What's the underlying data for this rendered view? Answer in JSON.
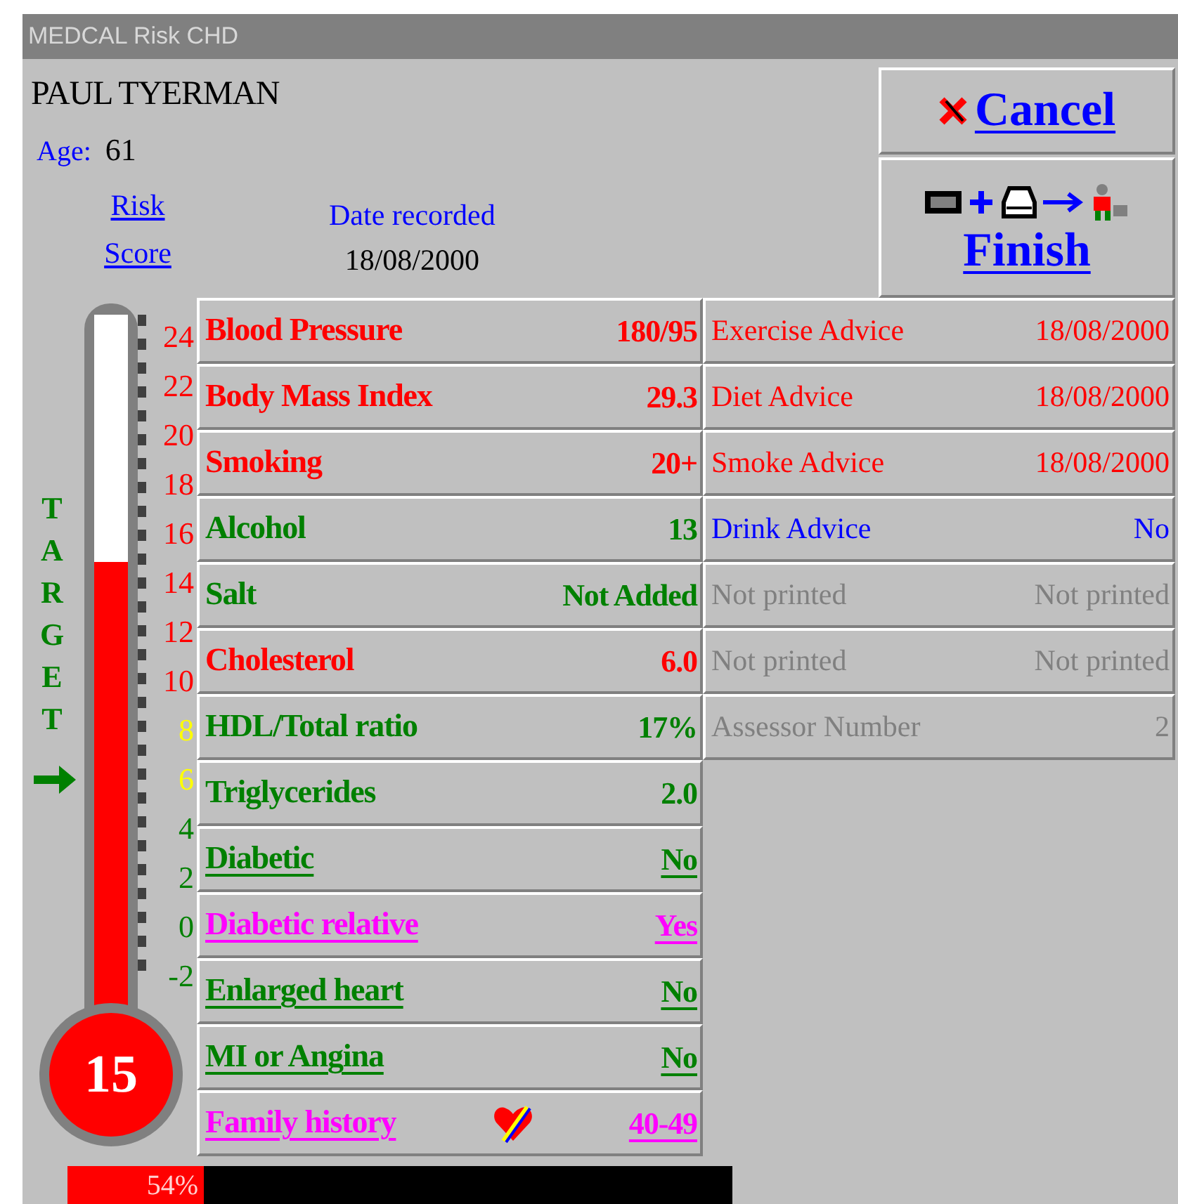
{
  "window": {
    "title": "MEDCAL Risk CHD"
  },
  "patient": {
    "name": "PAUL TYERMAN",
    "age_label": "Age:",
    "age": "61"
  },
  "risk_score_link": "Risk Score",
  "date_recorded": {
    "label": "Date recorded",
    "value": "18/08/2000"
  },
  "buttons": [
    {
      "kind": "cancel",
      "label": "Cancel"
    },
    {
      "kind": "finish",
      "label": "Finish"
    }
  ],
  "thermometer": {
    "target_label": "TARGET",
    "level": 0.67,
    "score": "15",
    "scale": [
      {
        "label": "24",
        "color": "#ff0000"
      },
      {
        "label": "22",
        "color": "#ff0000"
      },
      {
        "label": "20",
        "color": "#ff0000"
      },
      {
        "label": "18",
        "color": "#ff0000"
      },
      {
        "label": "16",
        "color": "#ff0000"
      },
      {
        "label": "14",
        "color": "#ff0000"
      },
      {
        "label": "12",
        "color": "#ff0000"
      },
      {
        "label": "10",
        "color": "#ff0000"
      },
      {
        "label": "8",
        "color": "#ffff00"
      },
      {
        "label": "6",
        "color": "#ffff00"
      },
      {
        "label": "4",
        "color": "#008000"
      },
      {
        "label": "2",
        "color": "#008000"
      },
      {
        "label": "0",
        "color": "#008000"
      },
      {
        "label": "-2",
        "color": "#008000"
      }
    ]
  },
  "factors": [
    {
      "kind": "plain",
      "label": "Blood Pressure",
      "value": "180/95",
      "color": "#ff0000"
    },
    {
      "kind": "plain",
      "label": "Body Mass Index",
      "value": "29.3",
      "color": "#ff0000"
    },
    {
      "kind": "plain",
      "label": "Smoking",
      "value": "20+",
      "color": "#ff0000"
    },
    {
      "kind": "plain",
      "label": "Alcohol",
      "value": "13",
      "color": "#008000"
    },
    {
      "kind": "plain",
      "label": "Salt",
      "value": "Not Added",
      "color": "#008000"
    },
    {
      "kind": "plain",
      "label": "Cholesterol",
      "value": "6.0",
      "color": "#ff0000"
    },
    {
      "kind": "plain",
      "label": "HDL/Total ratio",
      "value": "17%",
      "color": "#008000"
    },
    {
      "kind": "plain",
      "label": "Triglycerides",
      "value": "2.0",
      "color": "#008000"
    },
    {
      "kind": "link",
      "label": "Diabetic",
      "value": "No",
      "color": "#008000"
    },
    {
      "kind": "link",
      "label": "Diabetic relative",
      "value": "Yes",
      "color": "#ff00ff"
    },
    {
      "kind": "link",
      "label": "Enlarged heart",
      "value": "No",
      "color": "#008000"
    },
    {
      "kind": "link",
      "label": "MI or Angina",
      "value": "No",
      "color": "#008000"
    },
    {
      "kind": "link_icon",
      "label": "Family history",
      "value": "40-49",
      "color": "#ff00ff"
    }
  ],
  "advice": [
    {
      "label": "Exercise Advice",
      "value": "18/08/2000",
      "color": "#ff0000"
    },
    {
      "label": "Diet Advice",
      "value": "18/08/2000",
      "color": "#ff0000"
    },
    {
      "label": "Smoke Advice",
      "value": "18/08/2000",
      "color": "#ff0000"
    },
    {
      "label": "Drink Advice",
      "value": "No",
      "color": "#0000ff"
    },
    {
      "label": "Not printed",
      "value": "Not printed",
      "color": "#808080"
    },
    {
      "label": "Not printed",
      "value": "Not printed",
      "color": "#808080"
    },
    {
      "label": "Assessor Number",
      "value": "2",
      "color": "#808080"
    }
  ],
  "footer": {
    "percent": "54%"
  }
}
